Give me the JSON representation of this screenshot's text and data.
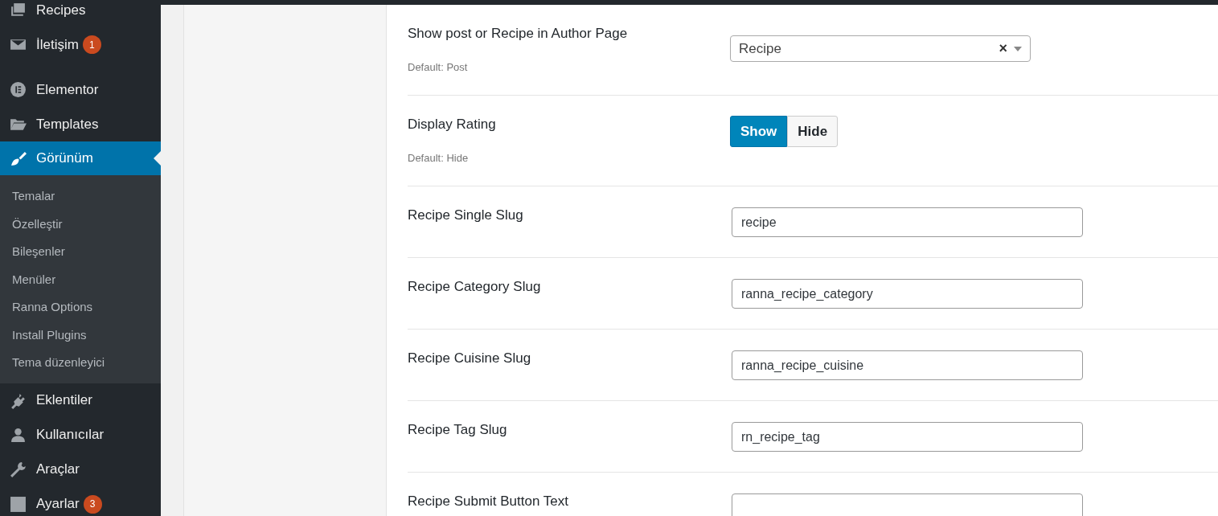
{
  "sidebar": {
    "items": [
      {
        "kind": "menu",
        "label": "Recipes",
        "selected": false
      },
      {
        "kind": "menu",
        "label": "İletişim",
        "badge": "1",
        "selected": false
      },
      {
        "kind": "gap"
      },
      {
        "kind": "menu",
        "label": "Elementor",
        "selected": false
      },
      {
        "kind": "menu",
        "label": "Templates",
        "selected": false
      },
      {
        "kind": "menu",
        "label": "Görünüm",
        "selected": true,
        "children": [
          {
            "label": "Temalar"
          },
          {
            "label": "Özelleştir"
          },
          {
            "label": "Bileşenler"
          },
          {
            "label": "Menüler"
          },
          {
            "label": "Ranna Options"
          },
          {
            "label": "Install Plugins"
          },
          {
            "label": "Tema düzenleyici"
          }
        ]
      },
      {
        "kind": "menu",
        "label": "Eklentiler",
        "selected": false
      },
      {
        "kind": "menu",
        "label": "Kullanıcılar",
        "selected": false
      },
      {
        "kind": "menu",
        "label": "Araçlar",
        "selected": false
      },
      {
        "kind": "menu",
        "label": "Ayarlar",
        "badge": "3",
        "selected": false
      }
    ]
  },
  "settings": [
    {
      "kind": "select",
      "label": "Show post or Recipe in Author Page",
      "default": "Default: Post",
      "value": "Recipe",
      "clear": "×"
    },
    {
      "kind": "toggle",
      "label": "Display Rating",
      "default": "Default: Hide",
      "options": [
        {
          "label": "Show",
          "selected": true
        },
        {
          "label": "Hide",
          "selected": false
        }
      ]
    },
    {
      "kind": "text",
      "label": "Recipe Single Slug",
      "value": "recipe"
    },
    {
      "kind": "text",
      "label": "Recipe Category Slug",
      "value": "ranna_recipe_category"
    },
    {
      "kind": "text",
      "label": "Recipe Cuisine Slug",
      "value": "ranna_recipe_cuisine"
    },
    {
      "kind": "text",
      "label": "Recipe Tag Slug",
      "value": "rn_recipe_tag"
    },
    {
      "kind": "text",
      "label": "Recipe Submit Button Text"
    }
  ]
}
